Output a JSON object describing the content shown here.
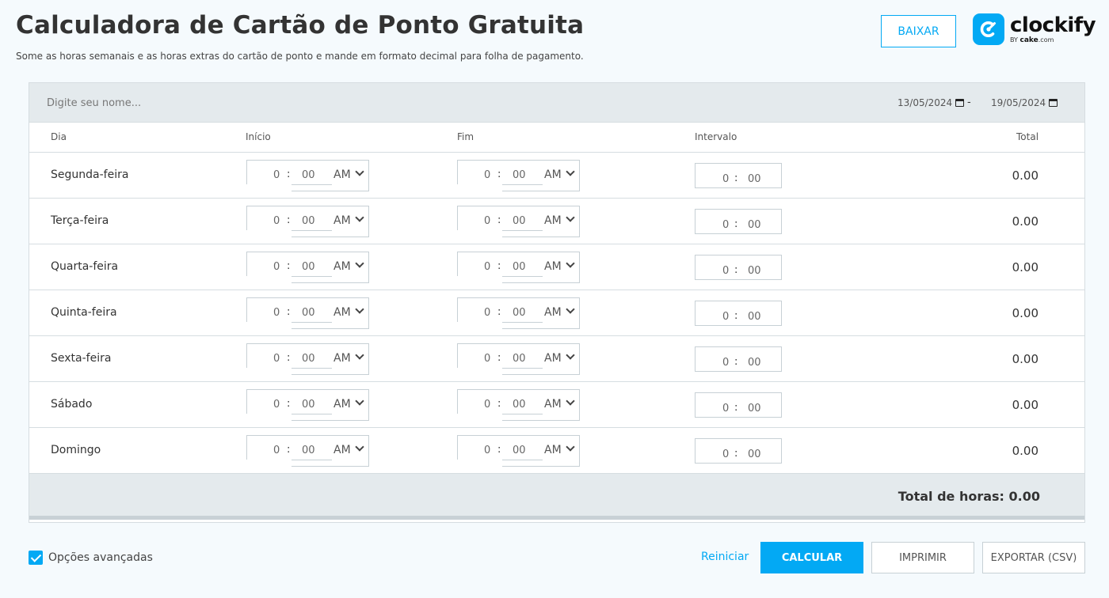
{
  "header": {
    "title": "Calculadora de Cartão de Ponto Gratuita",
    "subtitle": "Some as horas semanais e as horas extras do cartão de ponto e mande em formato decimal para folha de pagamento.",
    "download_label": "BAIXAR",
    "logo_text": "clockify",
    "logo_by": "BY",
    "logo_brand": "cake",
    "logo_domain": ".com"
  },
  "form": {
    "name_placeholder": "Digite seu nome...",
    "date_start": "13/05/2024",
    "date_separator": "-",
    "date_end": "19/05/2024"
  },
  "columns": {
    "day": "Dia",
    "start": "Início",
    "end": "Fim",
    "break": "Intervalo",
    "total": "Total"
  },
  "rows": [
    {
      "day": "Segunda-feira",
      "start_h": "0",
      "start_m": "00",
      "start_ampm": "AM",
      "end_h": "0",
      "end_m": "00",
      "end_ampm": "AM",
      "break_h": "0",
      "break_m": "00",
      "total": "0.00"
    },
    {
      "day": "Terça-feira",
      "start_h": "0",
      "start_m": "00",
      "start_ampm": "AM",
      "end_h": "0",
      "end_m": "00",
      "end_ampm": "AM",
      "break_h": "0",
      "break_m": "00",
      "total": "0.00"
    },
    {
      "day": "Quarta-feira",
      "start_h": "0",
      "start_m": "00",
      "start_ampm": "AM",
      "end_h": "0",
      "end_m": "00",
      "end_ampm": "AM",
      "break_h": "0",
      "break_m": "00",
      "total": "0.00"
    },
    {
      "day": "Quinta-feira",
      "start_h": "0",
      "start_m": "00",
      "start_ampm": "AM",
      "end_h": "0",
      "end_m": "00",
      "end_ampm": "AM",
      "break_h": "0",
      "break_m": "00",
      "total": "0.00"
    },
    {
      "day": "Sexta-feira",
      "start_h": "0",
      "start_m": "00",
      "start_ampm": "AM",
      "end_h": "0",
      "end_m": "00",
      "end_ampm": "AM",
      "break_h": "0",
      "break_m": "00",
      "total": "0.00"
    },
    {
      "day": "Sábado",
      "start_h": "0",
      "start_m": "00",
      "start_ampm": "AM",
      "end_h": "0",
      "end_m": "00",
      "end_ampm": "AM",
      "break_h": "0",
      "break_m": "00",
      "total": "0.00"
    },
    {
      "day": "Domingo",
      "start_h": "0",
      "start_m": "00",
      "start_ampm": "AM",
      "end_h": "0",
      "end_m": "00",
      "end_ampm": "AM",
      "break_h": "0",
      "break_m": "00",
      "total": "0.00"
    }
  ],
  "time_separator": ":",
  "summary": {
    "total_hours": "Total de horas: 0.00"
  },
  "footer": {
    "advanced_options_label": "Opções avançadas",
    "advanced_options_checked": true,
    "reset_label": "Reiniciar",
    "calculate_label": "CALCULAR",
    "print_label": "IMPRIMIR",
    "export_label": "EXPORTAR (CSV)"
  },
  "colors": {
    "accent": "#03a9f4",
    "header_bg": "#e4eaed"
  }
}
